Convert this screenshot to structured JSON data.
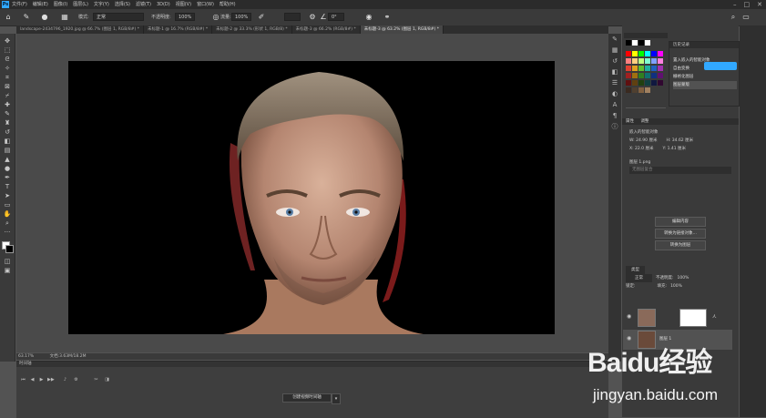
{
  "menubar": {
    "logo": "Ps",
    "items": [
      "文件(F)",
      "编辑(E)",
      "图像(I)",
      "图层(L)",
      "文字(Y)",
      "选择(S)",
      "滤镜(T)",
      "3D(D)",
      "视图(V)",
      "窗口(W)",
      "帮助(H)"
    ],
    "window_controls": [
      "–",
      "□",
      "✕"
    ]
  },
  "options": {
    "mode_label": "模式:",
    "mode_value": "正常",
    "opacity_label": "不透明度:",
    "opacity_value": "100%",
    "flow_label": "流量:",
    "flow_value": "100%",
    "angle_value": "0°"
  },
  "tabs": [
    {
      "label": "landscape-2434796_1920.jpg @ 66.7% (图层 1, RGB/8#) *",
      "active": false
    },
    {
      "label": "未标题-1 @ 16.7% (RGB/8#) *",
      "active": false
    },
    {
      "label": "未标题-2 @ 33.3% (形状 1, RGB/8) *",
      "active": false
    },
    {
      "label": "未标题-3 @ 66.2% (RGB/8#) *",
      "active": false
    },
    {
      "label": "未标题-3 @ 63.2% (图层 1, RGB/8#) *",
      "active": true
    }
  ],
  "canvas": {
    "zoom_readout": "63.17%",
    "doc_info": "文档:3.63M/18.2M"
  },
  "timeline": {
    "title": "时间轴",
    "create_button": "创建视频时间轴"
  },
  "history": {
    "items": [
      "置入嵌入的智能对象",
      "自由变换",
      "栅格化图层",
      "图层蒙版"
    ],
    "selected_index": 3
  },
  "properties": {
    "tabs": [
      "属性",
      "调整"
    ],
    "type_label": "嵌入的智能对象",
    "w_label": "W: 24.90 厘米",
    "h_label": "H: 34.62 厘米",
    "x_label": "X: 22.0 厘米",
    "y_label": "Y: 1.41 厘米",
    "file_label": "图层 1.png",
    "no_comp": "无图层复合",
    "buttons": [
      "编辑内容",
      "转换为链接对象...",
      "转换为图层"
    ]
  },
  "layers": {
    "kind_label": "类型",
    "blend_value": "正常",
    "opacity_label": "不透明度:",
    "opacity_value": "100%",
    "lock_label": "锁定:",
    "fill_label": "填充:",
    "fill_value": "100%",
    "rows": [
      {
        "name": "人"
      },
      {
        "name": "图层 1"
      }
    ]
  },
  "watermark": {
    "logo_text": "Baidu经验",
    "url": "jingyan.baidu.com"
  },
  "colors": {
    "accent": "#31a8ff",
    "panel": "#3a3a3a",
    "canvas_bg": "#4a4a4a"
  }
}
